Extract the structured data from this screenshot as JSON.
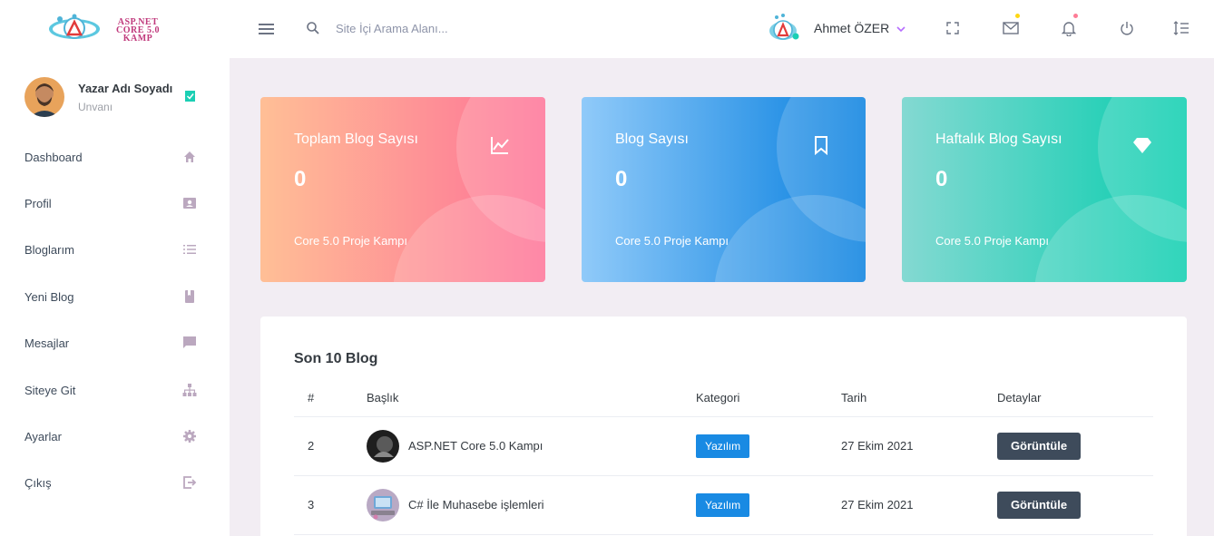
{
  "brand": {
    "logo_text": "ASP.NET\nCORE 5.0\nKAMP"
  },
  "navbar": {
    "search_placeholder": "Site İçi Arama Alanı...",
    "user_name": "Ahmet ÖZER"
  },
  "sidebar": {
    "profile_name": "Yazar Adı Soyadı",
    "profile_title": "Unvanı",
    "items": [
      {
        "label": "Dashboard",
        "icon": "home-icon"
      },
      {
        "label": "Profil",
        "icon": "contacts-icon"
      },
      {
        "label": "Bloglarım",
        "icon": "list-icon"
      },
      {
        "label": "Yeni Blog",
        "icon": "book-icon"
      },
      {
        "label": "Mesajlar",
        "icon": "message-icon"
      },
      {
        "label": "Siteye Git",
        "icon": "sitemap-icon"
      },
      {
        "label": "Ayarlar",
        "icon": "gear-icon"
      },
      {
        "label": "Çıkış",
        "icon": "logout-icon"
      }
    ]
  },
  "cards": [
    {
      "title": "Toplam Blog Sayısı",
      "value": "0",
      "subtitle": "Core 5.0 Proje Kampı",
      "icon": "chart-line-icon",
      "gradient": [
        "#ffbf96",
        "#fe7096"
      ]
    },
    {
      "title": "Blog Sayısı",
      "value": "0",
      "subtitle": "Core 5.0 Proje Kampı",
      "icon": "bookmark-icon",
      "gradient": [
        "#90caf9",
        "#047edf"
      ]
    },
    {
      "title": "Haftalık Blog Sayısı",
      "value": "0",
      "subtitle": "Core 5.0 Proje Kampı",
      "icon": "diamond-icon",
      "gradient": [
        "#84d9d2",
        "#07cdae"
      ]
    }
  ],
  "table": {
    "title": "Son 10 Blog",
    "headers": [
      "#",
      "Başlık",
      "Kategori",
      "Tarih",
      "Detaylar"
    ],
    "rows": [
      {
        "id": "2",
        "title": "ASP.NET Core 5.0 Kampı",
        "category": "Yazılım",
        "date": "27 Ekim 2021",
        "action": "Görüntüle"
      },
      {
        "id": "3",
        "title": "C# İle Muhasebe işlemleri",
        "category": "Yazılım",
        "date": "27 Ekim 2021",
        "action": "Görüntüle"
      }
    ]
  },
  "colors": {
    "accent_blue": "#198ae3",
    "dark_button": "#3e4b5b",
    "background": "#f2edf3"
  }
}
